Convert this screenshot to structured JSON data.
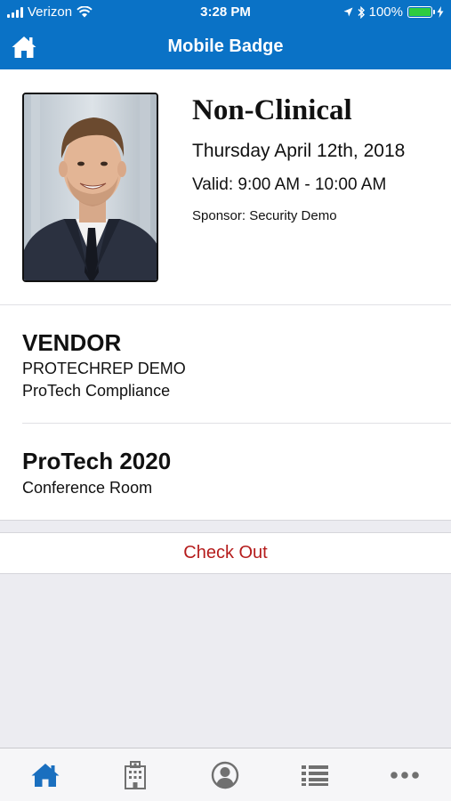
{
  "status": {
    "carrier": "Verizon",
    "time": "3:28 PM",
    "battery": "100%"
  },
  "nav": {
    "title": "Mobile Badge"
  },
  "badge": {
    "type": "Non-Clinical",
    "date": "Thursday April 12th, 2018",
    "valid": "Valid: 9:00 AM - 10:00 AM",
    "sponsor": "Sponsor: Security Demo"
  },
  "visitor": {
    "role": "VENDOR",
    "name": "PROTECHREP DEMO",
    "company": "ProTech Compliance"
  },
  "event": {
    "name": "ProTech 2020",
    "location": "Conference Room"
  },
  "actions": {
    "checkout_label": "Check Out"
  },
  "tabs": [
    {
      "icon": "home-icon",
      "active": true
    },
    {
      "icon": "building-icon",
      "active": false
    },
    {
      "icon": "profile-icon",
      "active": false
    },
    {
      "icon": "list-icon",
      "active": false
    },
    {
      "icon": "more-icon",
      "active": false
    }
  ],
  "colors": {
    "brand": "#0a72c6",
    "checkout": "#b51c1c",
    "tab_active": "#1a6fbf",
    "tab_inactive": "#707070"
  }
}
